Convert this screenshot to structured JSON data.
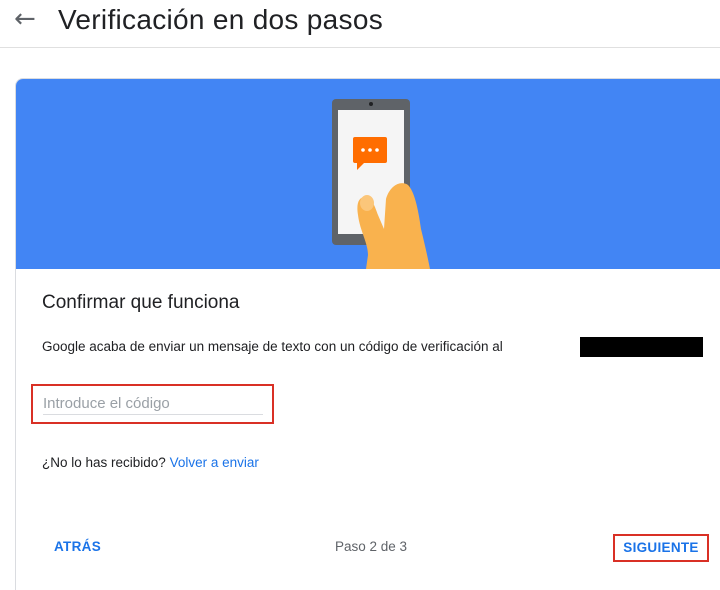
{
  "header": {
    "back_icon": "arrow-left-icon",
    "title": "Verificación en dos pasos"
  },
  "banner": {
    "illustration": "phone-in-hand-illustration",
    "message_icon": "chat-bubble-icon",
    "colors": {
      "background": "#4285f4",
      "phone": "#5f6368",
      "message_bubble": "#ff6d00",
      "hand": "#f9b24e"
    }
  },
  "card": {
    "title": "Confirmar que funciona",
    "description": "Google acaba de enviar un mensaje de texto con un código de verificación al",
    "code_input": {
      "placeholder": "Introduce el código",
      "value": ""
    },
    "resend_prompt": "¿No lo has recibido?",
    "resend_link": "Volver a enviar"
  },
  "footer": {
    "back_label": "ATRÁS",
    "step_text": "Paso 2 de 3",
    "next_label": "SIGUIENTE"
  },
  "colors": {
    "accent": "#1a73e8",
    "highlight_border": "#d93025"
  }
}
